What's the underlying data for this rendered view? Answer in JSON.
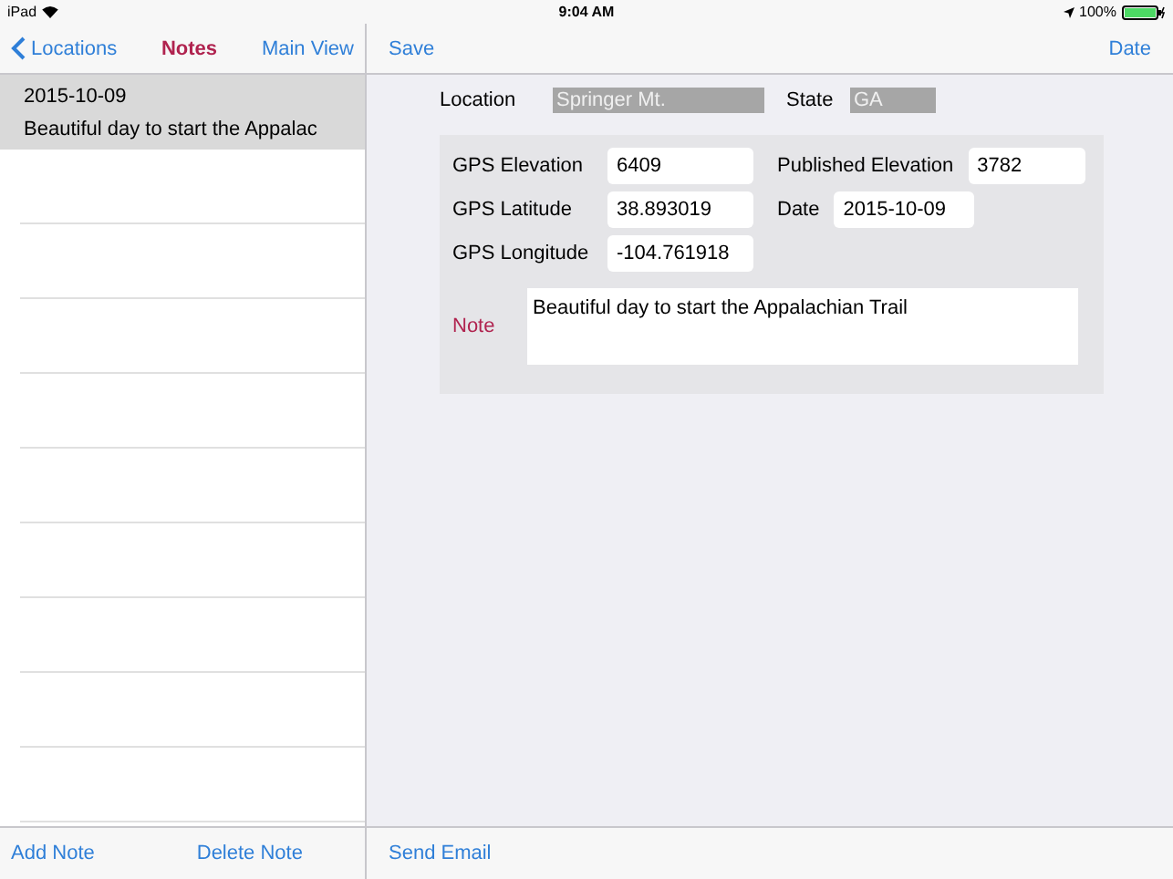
{
  "status_bar": {
    "device": "iPad",
    "time": "9:04 AM",
    "battery": "100%"
  },
  "sidebar": {
    "back": "Locations",
    "title": "Notes",
    "action": "Main View",
    "items": [
      {
        "date": "2015-10-09",
        "text": "Beautiful day to start the Appalac",
        "selected": true
      }
    ],
    "toolbar": [
      "Add Note",
      "Delete Note"
    ]
  },
  "detail": {
    "save": "Save",
    "date_button": "Date",
    "location": {
      "label": "Location",
      "value": "Springer Mt."
    },
    "state": {
      "label": "State",
      "value": "GA"
    },
    "fields": [
      {
        "label": "GPS Elevation",
        "value": "6409"
      },
      {
        "label": "Published Elevation",
        "value": "3782"
      },
      {
        "label": "GPS Latitude",
        "value": "38.893019"
      },
      {
        "label": "Date",
        "value": "2015-10-09"
      },
      {
        "label": "GPS Longitude",
        "value": "-104.761918"
      }
    ],
    "note": {
      "label": "Note",
      "value": "Beautiful day to start the Appalachian Trail"
    },
    "toolbar": [
      "Send Email"
    ]
  }
}
